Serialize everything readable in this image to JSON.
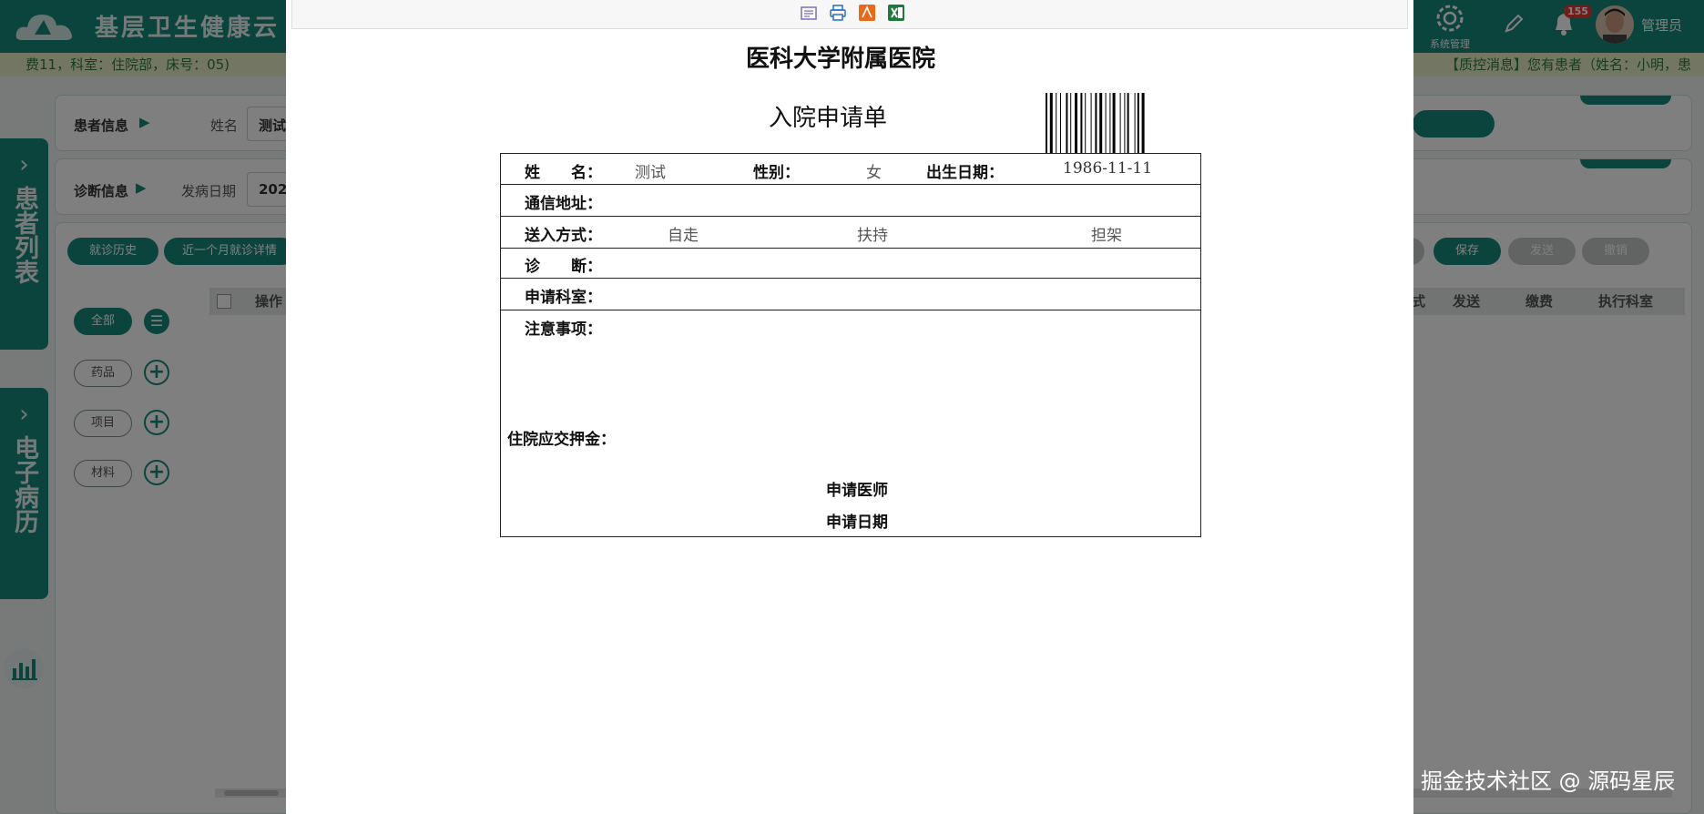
{
  "app": {
    "title": "基层卫生健康云",
    "patient_info_line": "费11，科室：住院部，床号：05)",
    "qc_message": "【质控消息】您有患者（姓名：小明，患",
    "notification_count": "155",
    "system_mgmt_label": "系统管理",
    "user_name": "管理员"
  },
  "side_tabs": {
    "patient_list": "患者列表",
    "emr": "电子病历"
  },
  "panels": {
    "patient": {
      "label": "患者信息",
      "name_label": "姓名",
      "name_value": "测试"
    },
    "diagnosis": {
      "label": "诊断信息",
      "onset_label": "发病日期",
      "onset_value": "202"
    }
  },
  "buttons": {
    "history": "就诊历史",
    "recent_month": "近一个月就诊详情",
    "save": "保存",
    "send": "发送",
    "cancel": "撤销"
  },
  "categories": {
    "all": "全部",
    "drug": "药品",
    "item": "项目",
    "material": "材料"
  },
  "order_table": {
    "col_op": "操作",
    "col_send": "发送",
    "col_fee": "缴费",
    "col_dept": "执行科室",
    "col_partial": "式"
  },
  "print_preview": {
    "hospital_name": "医科大学附属医院",
    "form_title": "入院申请单",
    "labels": {
      "name": "姓　　名：",
      "gender": "性别：",
      "birth": "出生日期：",
      "address": "通信地址：",
      "admission_mode": "送入方式：",
      "diagnosis": "诊　　断：",
      "dept": "申请科室：",
      "notes": "注意事项：",
      "deposit": "住院应交押金：",
      "doctor": "申请医师",
      "date": "申请日期"
    },
    "values": {
      "name": "测试",
      "gender": "女",
      "birth": "1986-11-11",
      "mode_walk": "自走",
      "mode_assist": "扶持",
      "mode_stretcher": "担架"
    }
  },
  "watermark": "掘金技术社区 @ 源码星辰",
  "colors": {
    "brand": "#16887a",
    "overlay": "rgba(0,0,0,0.5)"
  }
}
